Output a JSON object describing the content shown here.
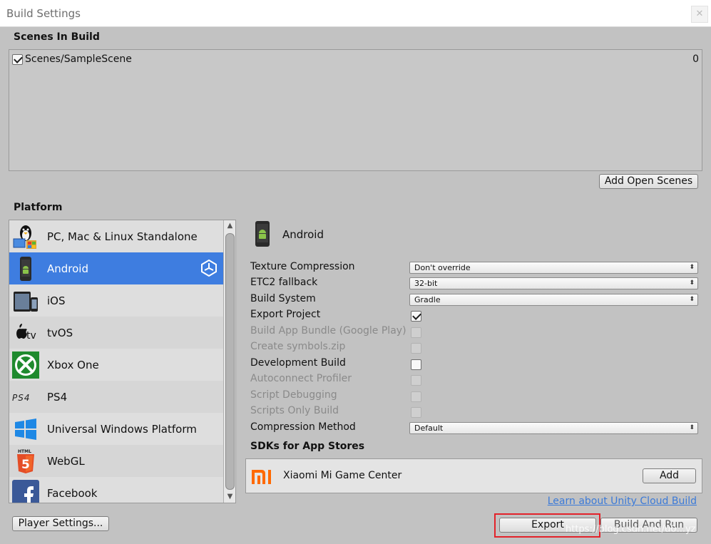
{
  "window": {
    "title": "Build Settings",
    "close_glyph": "✕"
  },
  "scenes": {
    "label": "Scenes In Build",
    "items": [
      {
        "name": "Scenes/SampleScene",
        "index": "0",
        "checked": true
      }
    ],
    "add_open_scenes_label": "Add Open Scenes"
  },
  "platform": {
    "label": "Platform",
    "items": [
      {
        "label": "PC, Mac & Linux Standalone",
        "icon": "penguin-icon"
      },
      {
        "label": "Android",
        "icon": "android-phone-icon",
        "selected": true
      },
      {
        "label": "iOS",
        "icon": "ios-devices-icon"
      },
      {
        "label": "tvOS",
        "icon": "apple-tv-icon"
      },
      {
        "label": "Xbox One",
        "icon": "xbox-icon"
      },
      {
        "label": "PS4",
        "icon": "ps4-logo-icon"
      },
      {
        "label": "Universal Windows Platform",
        "icon": "windows-icon"
      },
      {
        "label": "WebGL",
        "icon": "html5-icon"
      },
      {
        "label": "Facebook",
        "icon": "facebook-icon"
      }
    ]
  },
  "selected_platform": {
    "label": "Android"
  },
  "options": {
    "texture_compression": {
      "label": "Texture Compression",
      "value": "Don't override"
    },
    "etc2_fallback": {
      "label": "ETC2 fallback",
      "value": "32-bit"
    },
    "build_system": {
      "label": "Build System",
      "value": "Gradle"
    },
    "export_project": {
      "label": "Export Project",
      "checked": true
    },
    "build_app_bundle": {
      "label": "Build App Bundle (Google Play)",
      "checked": false,
      "enabled": false
    },
    "create_symbols": {
      "label": "Create symbols.zip",
      "checked": false,
      "enabled": false
    },
    "development_build": {
      "label": "Development Build",
      "checked": false
    },
    "autoconnect_profiler": {
      "label": "Autoconnect Profiler",
      "checked": false,
      "enabled": false
    },
    "script_debugging": {
      "label": "Script Debugging",
      "checked": false,
      "enabled": false
    },
    "scripts_only_build": {
      "label": "Scripts Only Build",
      "checked": false,
      "enabled": false
    },
    "compression_method": {
      "label": "Compression Method",
      "value": "Default"
    }
  },
  "sdks": {
    "label": "SDKs for App Stores",
    "items": [
      {
        "name": "Xiaomi Mi Game Center",
        "icon": "xiaomi-mi-icon",
        "action": "Add"
      }
    ]
  },
  "footer": {
    "cloud_link": "Learn about Unity Cloud Build",
    "player_settings": "Player Settings...",
    "export": "Export",
    "build_and_run": "Build And Run",
    "watermark": "https://blog.csdn.net/u0...yz"
  },
  "colors": {
    "selection": "#3e7de0",
    "highlight_border": "#e3222a",
    "link": "#3b7ad8"
  }
}
